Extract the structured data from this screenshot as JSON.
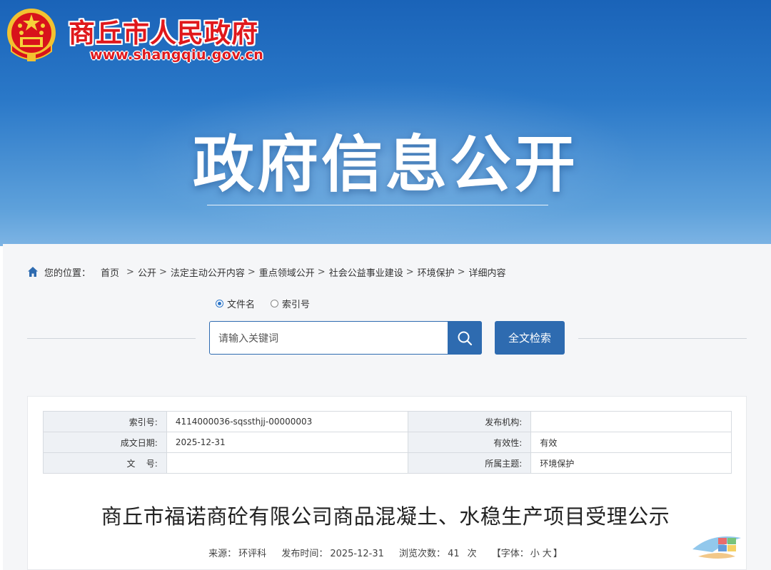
{
  "header": {
    "site_name": "商丘市人民政府",
    "site_url": "www.shangqiu.gov.cn",
    "banner_title": "政府信息公开",
    "colors": {
      "accent_red": "#e0181c",
      "primary_blue": "#2e6bb0"
    }
  },
  "breadcrumb": {
    "label": "您的位置：",
    "items": [
      "首页",
      "公开",
      "法定主动公开内容",
      "重点领域公开",
      "社会公益事业建设",
      "环境保护",
      "详细内容"
    ],
    "separator": ">"
  },
  "search": {
    "options": [
      {
        "label": "文件名",
        "checked": true
      },
      {
        "label": "索引号",
        "checked": false
      }
    ],
    "placeholder": "请输入关键词",
    "search_icon": "search-icon",
    "fulltext_button": "全文检索"
  },
  "meta_table": {
    "rows": [
      {
        "label1": "索引号:",
        "value1": "4114000036-sqssthjj-00000003",
        "label2": "发布机构:",
        "value2": ""
      },
      {
        "label1": "成文日期:",
        "value1": "2025-12-31",
        "label2": "有效性:",
        "value2": "有效"
      },
      {
        "label1": "文    号:",
        "value1": "",
        "label2": "所属主题:",
        "value2": "环境保护"
      }
    ]
  },
  "article": {
    "title": "商丘市福诺商砼有限公司商品混凝土、水稳生产项目受理公示",
    "source_label": "来源：",
    "source": "环评科",
    "publish_label": "发布时间：",
    "publish_time": "2025-12-31",
    "views_label": "浏览次数：",
    "views": "41",
    "views_unit": "次",
    "font_label": "【字体：",
    "font_small": "小",
    "font_large": "大",
    "font_close": "】"
  }
}
